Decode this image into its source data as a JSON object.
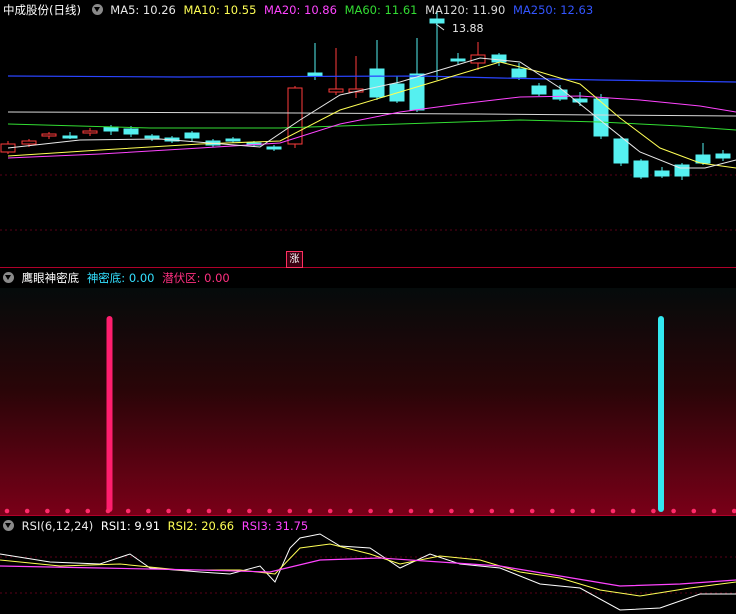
{
  "main_panel": {
    "title": "中成股份(日线)",
    "ma": [
      {
        "label": "MA5: 10.26",
        "color": "#e8e8e8"
      },
      {
        "label": "MA10: 10.55",
        "color": "#ffff55"
      },
      {
        "label": "MA20: 10.86",
        "color": "#ff44ff"
      },
      {
        "label": "MA60: 11.61",
        "color": "#33dd33"
      },
      {
        "label": "MA120: 11.90",
        "color": "#d8d8d8"
      },
      {
        "label": "MA250: 12.63",
        "color": "#3355ff"
      }
    ],
    "high_label": "13.88",
    "signal_badge": "涨"
  },
  "indicator_panel": {
    "title": "鹰眼神密底",
    "items": [
      {
        "label": "神密底: 0.00",
        "color": "#33e0ff"
      },
      {
        "label": "潜伏区: 0.00",
        "color": "#ff3080"
      }
    ]
  },
  "rsi_panel": {
    "title": "RSI(6,12,24)",
    "items": [
      {
        "label": "RSI1: 9.91",
        "color": "#ffffff"
      },
      {
        "label": "RSI2: 20.66",
        "color": "#ffff55"
      },
      {
        "label": "RSI3: 31.75",
        "color": "#ff44ff"
      }
    ]
  },
  "colors": {
    "up": "#ff3b3b",
    "down": "#55f0f0",
    "panel_border": "#b0002a"
  },
  "icons": [
    "dropdown-icon"
  ]
}
